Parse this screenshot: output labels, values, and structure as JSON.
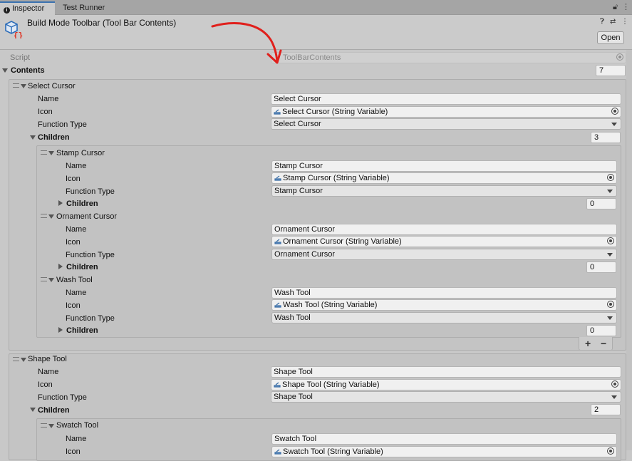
{
  "tabs": [
    {
      "label": "Inspector",
      "icon": "info-icon"
    },
    {
      "label": "Test Runner"
    }
  ],
  "header": {
    "title": "Build Mode Toolbar (Tool Bar Contents)",
    "open_label": "Open"
  },
  "script": {
    "label": "Script",
    "value": "ToolBarContents"
  },
  "contents": {
    "label": "Contents",
    "count": "7"
  },
  "field_labels": {
    "name": "Name",
    "icon": "Icon",
    "function_type": "Function Type",
    "children": "Children"
  },
  "items": {
    "select_cursor": {
      "title": "Select Cursor",
      "name": "Select Cursor",
      "icon": "Select Cursor (String Variable)",
      "function_type": "Select Cursor",
      "children_count": "3"
    },
    "stamp_cursor": {
      "title": "Stamp Cursor",
      "name": "Stamp Cursor",
      "icon": "Stamp Cursor (String Variable)",
      "function_type": "Stamp Cursor",
      "children_count": "0"
    },
    "ornament_cursor": {
      "title": "Ornament Cursor",
      "name": "Ornament Cursor",
      "icon": "Ornament Cursor (String Variable)",
      "function_type": "Ornament Cursor",
      "children_count": "0"
    },
    "wash_tool": {
      "title": "Wash Tool",
      "name": "Wash Tool",
      "icon": "Wash Tool (String Variable)",
      "function_type": "Wash Tool",
      "children_count": "0"
    },
    "shape_tool": {
      "title": "Shape Tool",
      "name": "Shape Tool",
      "icon": "Shape Tool (String Variable)",
      "function_type": "Shape Tool",
      "children_count": "2"
    },
    "swatch_tool": {
      "title": "Swatch Tool",
      "name": "Swatch Tool",
      "icon": "Swatch Tool (String Variable)"
    }
  },
  "list_controls": {
    "add": "+",
    "remove": "−"
  },
  "annotation": {
    "color": "#e0201c"
  }
}
